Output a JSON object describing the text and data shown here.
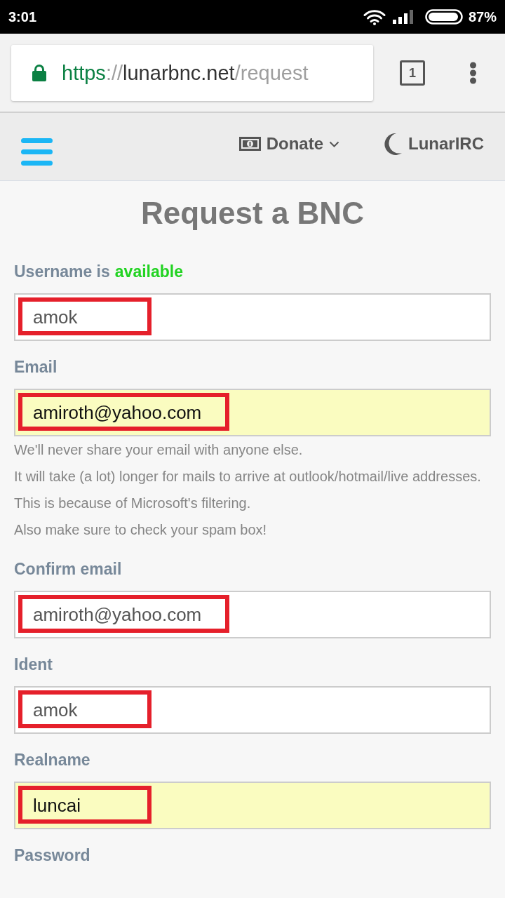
{
  "status_bar": {
    "time": "3:01",
    "battery": "87%"
  },
  "browser": {
    "url": {
      "scheme": "https",
      "separator": "://",
      "host": "lunarbnc.net",
      "path": "/request"
    },
    "tab_count": "1"
  },
  "navbar": {
    "items": [
      {
        "kind": "dropdown",
        "label": "Donate"
      },
      {
        "kind": "link",
        "label": "LunarIRC"
      }
    ]
  },
  "page": {
    "title": "Request a BNC",
    "fields": [
      {
        "label": "Username is",
        "status": "available",
        "value": "amok",
        "autofilled": false,
        "highlighted": true
      },
      {
        "label": "Email",
        "value": "amiroth@yahoo.com",
        "autofilled": true,
        "highlighted": true,
        "help": [
          "We'll never share your email with anyone else.",
          "It will take (a lot) longer for mails to arrive at outlook/hotmail/live addresses.",
          "This is because of Microsoft's filtering.",
          "Also make sure to check your spam box!"
        ]
      },
      {
        "label": "Confirm email",
        "value": "amiroth@yahoo.com",
        "autofilled": false,
        "highlighted": true
      },
      {
        "label": "Ident",
        "value": "amok",
        "autofilled": false,
        "highlighted": true
      },
      {
        "label": "Realname",
        "value": "luncai",
        "autofilled": true,
        "highlighted": true
      },
      {
        "label": "Password"
      }
    ]
  }
}
